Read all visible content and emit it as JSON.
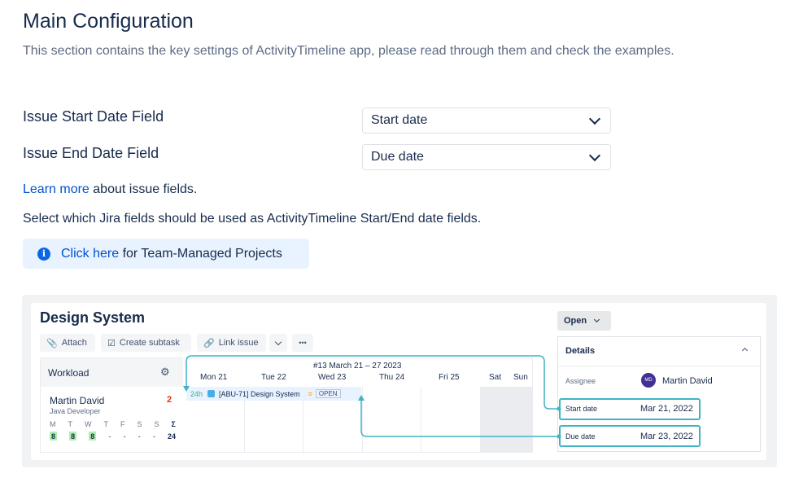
{
  "header": {
    "title": "Main Configuration",
    "description": "This section contains the key settings of ActivityTimeline app, please read through them and check the examples."
  },
  "fields": [
    {
      "label": "Issue Start Date Field",
      "value": "Start date"
    },
    {
      "label": "Issue End Date Field",
      "value": "Due date"
    }
  ],
  "learn": {
    "link": "Learn more",
    "rest": " about issue fields."
  },
  "select_text": "Select which Jira fields should be used as ActivityTimeline Start/End date fields.",
  "banner": {
    "link": "Click here",
    "rest": " for Team-Managed Projects"
  },
  "preview": {
    "title": "Design System",
    "toolbar": {
      "attach": "Attach",
      "subtask": "Create subtask",
      "link": "Link issue",
      "more": "•••"
    },
    "status": "Open",
    "workload_label": "Workload",
    "week_label": "#13 March 21 – 27 2023",
    "days": [
      "Mon 21",
      "Tue 22",
      "Wed 23",
      "Thu 24",
      "Fri 25",
      "Sat",
      "Sun"
    ],
    "user": {
      "name": "Martin David",
      "role": "Java Developer",
      "count": "2",
      "initials": "MD"
    },
    "weekday_letters": [
      "M",
      "T",
      "W",
      "T",
      "F",
      "S",
      "S",
      "Σ"
    ],
    "weekday_values": [
      "8",
      "8",
      "8",
      "-",
      "-",
      "-",
      "-",
      "24"
    ],
    "task": {
      "hours": "24h",
      "key_title": "[ABU-71] Design System",
      "status": "OPEN"
    },
    "details": {
      "title": "Details",
      "assignee_label": "Assignee",
      "assignee": "Martin David",
      "start_label": "Start date",
      "start_value": "Mar 21, 2022",
      "due_label": "Due date",
      "due_value": "Mar 23, 2022"
    }
  }
}
